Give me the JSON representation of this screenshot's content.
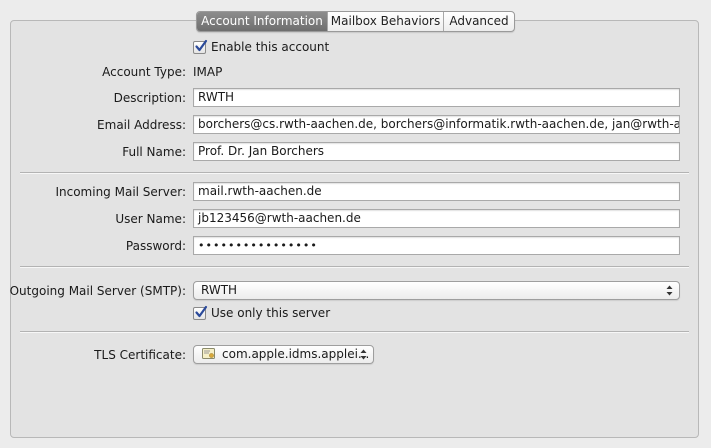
{
  "tabs": [
    {
      "label": "Account Information",
      "active": true
    },
    {
      "label": "Mailbox Behaviors",
      "active": false
    },
    {
      "label": "Advanced",
      "active": false
    }
  ],
  "enable_account": {
    "label": "Enable this account",
    "checked": true
  },
  "account_type": {
    "label": "Account Type:",
    "value": "IMAP"
  },
  "description": {
    "label": "Description:",
    "value": "RWTH"
  },
  "email": {
    "label": "Email Address:",
    "value": "borchers@cs.rwth-aachen.de, borchers@informatik.rwth-aachen.de, jan@rwth-aachen.de"
  },
  "full_name": {
    "label": "Full Name:",
    "value": "Prof. Dr. Jan Borchers"
  },
  "incoming_server": {
    "label": "Incoming Mail Server:",
    "value": "mail.rwth-aachen.de"
  },
  "user_name": {
    "label": "User Name:",
    "value": "jb123456@rwth-aachen.de"
  },
  "password": {
    "label": "Password:",
    "value": "••••••••••••••••"
  },
  "outgoing_server": {
    "label": "Outgoing Mail Server (SMTP):",
    "value": "RWTH"
  },
  "use_only_server": {
    "label": "Use only this server",
    "checked": true
  },
  "tls_certificate": {
    "label": "TLS Certificate:",
    "value": "com.apple.idms.applei..."
  },
  "colors": {
    "checkmark": "#2b4a9a",
    "active_tab": "#7a7a7a"
  }
}
